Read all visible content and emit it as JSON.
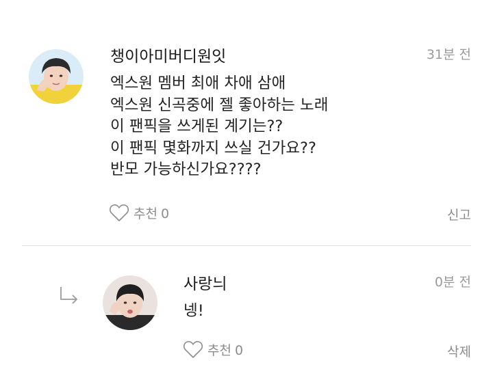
{
  "comment": {
    "author": "챙이아미버디원잇",
    "time": "31분 전",
    "lines": [
      "엑스원 멤버 최애 차애 삼애",
      "엑스원 신곡중에 젤 좋아하는 노래",
      "이 팬픽을 쓰게된 계기는??",
      "이 팬픽 몇화까지 쓰실 건가요??",
      "반모 가능하신가요????"
    ],
    "like_label": "추천",
    "like_count": "0",
    "action_label": "신고"
  },
  "reply": {
    "author": "사랑늬",
    "time": "0분 전",
    "text": "넹!",
    "like_label": "추천",
    "like_count": "0",
    "action_label": "삭제"
  },
  "icons": {
    "like": "heart-outline-icon",
    "reply": "reply-arrow-icon"
  },
  "colors": {
    "muted": "#8c8c8c",
    "divider": "#dedede"
  }
}
